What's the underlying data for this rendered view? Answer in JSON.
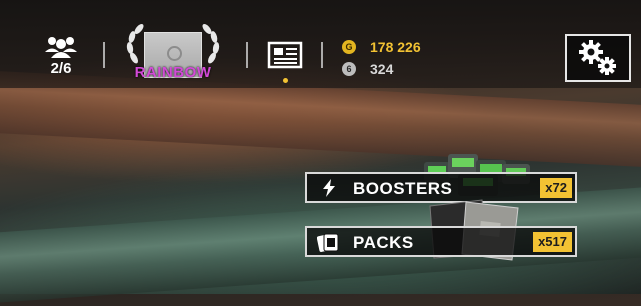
{
  "header": {
    "friends": {
      "icon": "friends-icon",
      "count": "2/6"
    },
    "profile": {
      "rank": "RAINBOW",
      "rank_color": "#d34ad8"
    },
    "news": {
      "icon": "newspaper-icon",
      "has_notification": true
    },
    "currency": {
      "gold": {
        "icon_letter": "G",
        "value": "178 226",
        "color": "#f2c233"
      },
      "silver": {
        "icon_letter": "6",
        "value": "324"
      }
    },
    "settings": {
      "icon": "gears-icon"
    }
  },
  "shop": {
    "boosters": {
      "label": "BOOSTERS",
      "count": "x72",
      "icon": "lightning-icon"
    },
    "packs": {
      "label": "PACKS",
      "count": "x517",
      "icon": "cards-icon"
    }
  },
  "colors": {
    "accent": "#f2c233",
    "border": "#d9d9d9"
  }
}
